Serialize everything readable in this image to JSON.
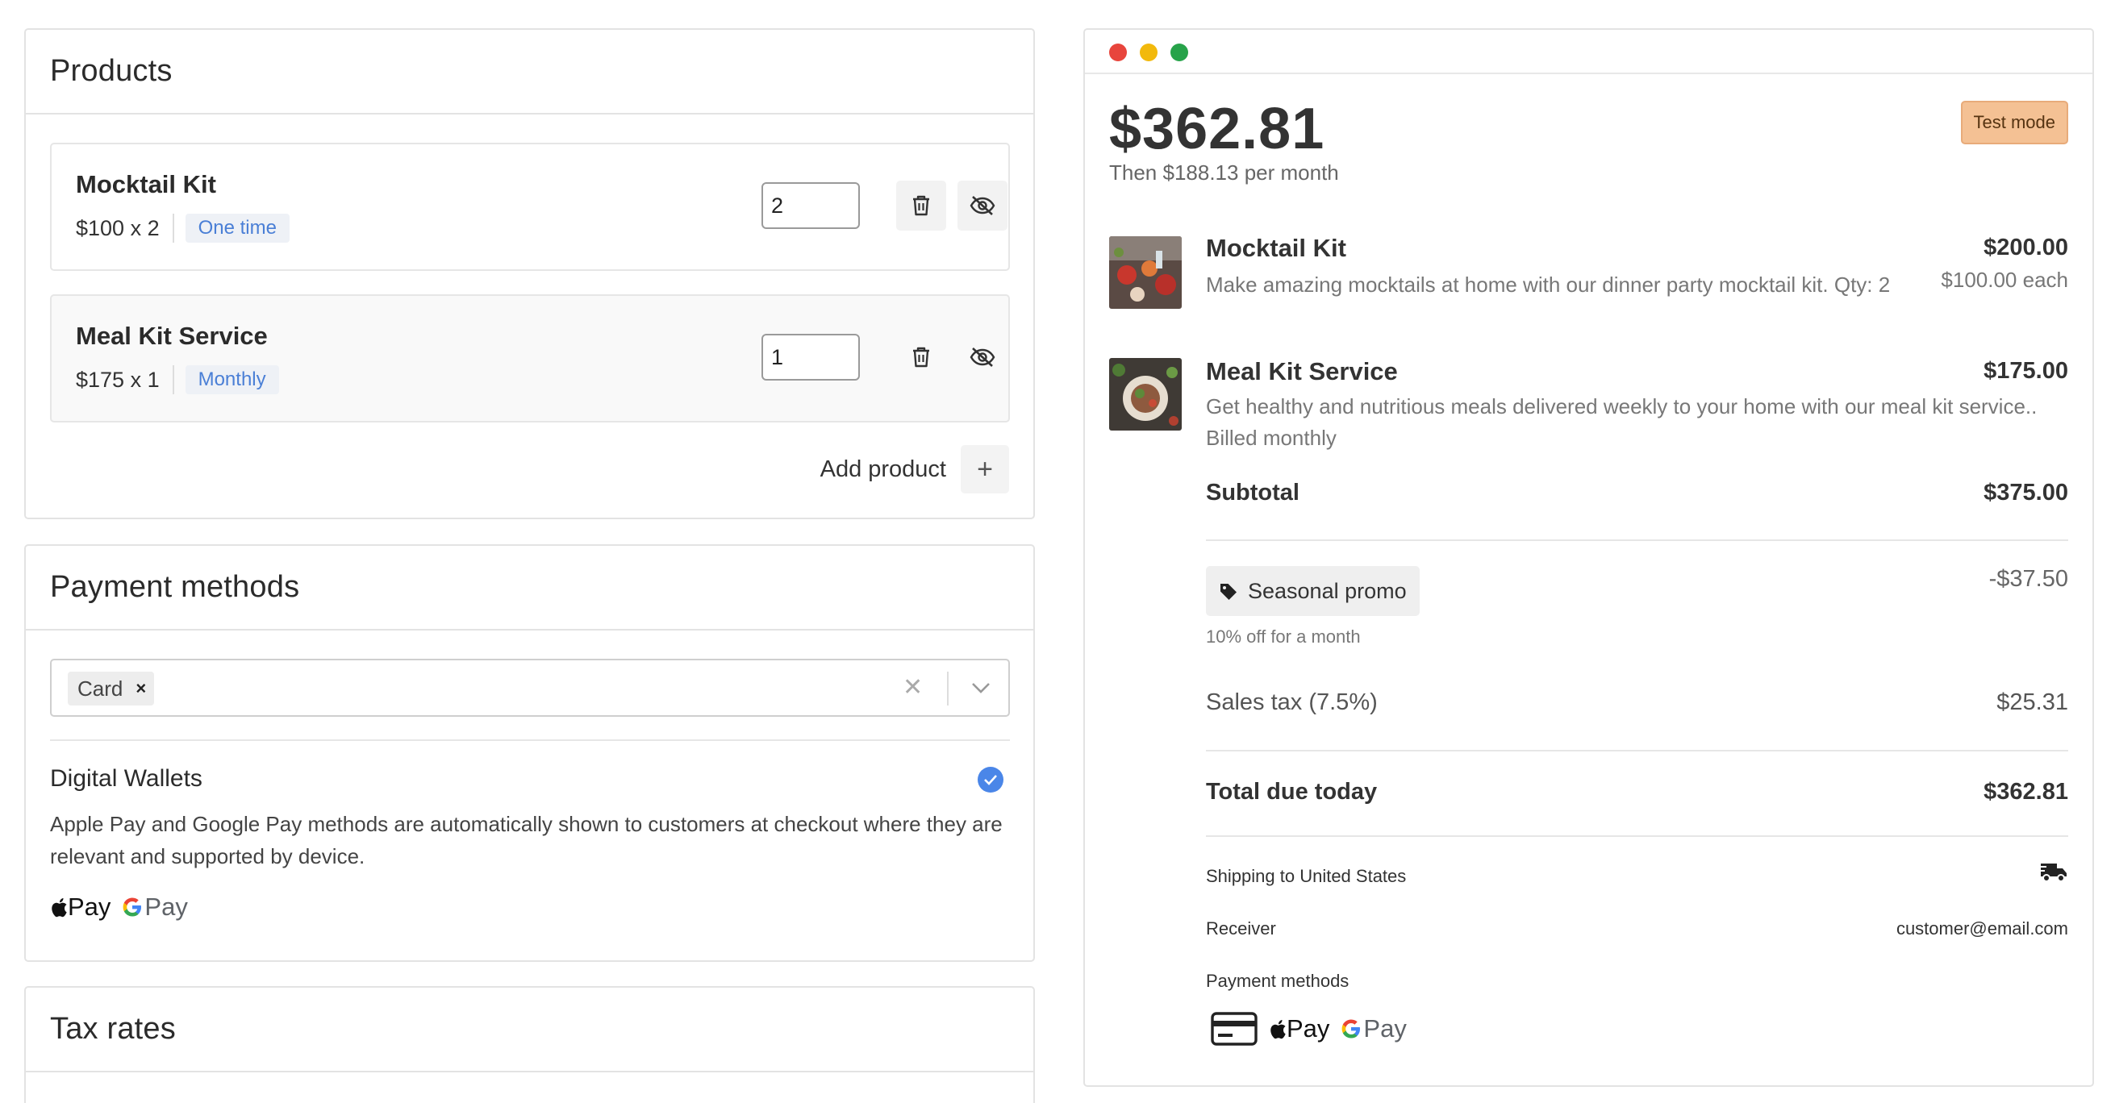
{
  "products_card": {
    "title": "Products",
    "items": [
      {
        "name": "Mocktail Kit",
        "price_line": "$100 x 2",
        "badge": "One time",
        "quantity": "2"
      },
      {
        "name": "Meal Kit Service",
        "price_line": "$175 x 1",
        "badge": "Monthly",
        "quantity": "1"
      }
    ],
    "add_label": "Add product",
    "add_icon": "+"
  },
  "payment_card": {
    "title": "Payment methods",
    "selected": [
      "Card"
    ],
    "chip_remove": "×",
    "clear_icon": "✕",
    "digital_wallets_title": "Digital Wallets",
    "digital_wallets_desc": "Apple Pay and Google Pay methods are automatically shown to customers at checkout where they are relevant and supported by device.",
    "apple_pay": "Pay",
    "google_pay": "Pay"
  },
  "tax_card": {
    "title": "Tax rates"
  },
  "preview": {
    "test_mode": "Test mode",
    "total_amount": "$362.81",
    "then_text": "Then $188.13 per month",
    "line_items": [
      {
        "name": "Mocktail Kit",
        "description": "Make amazing mocktails at home with our dinner party mocktail kit. Qty: 2",
        "price": "$200.00",
        "each": "$100.00 each"
      },
      {
        "name": "Meal Kit Service",
        "description": "Get healthy and nutritious meals delivered weekly to your home with our meal kit service.. Billed monthly",
        "price": "$175.00"
      }
    ],
    "subtotal_label": "Subtotal",
    "subtotal_value": "$375.00",
    "promo_name": "Seasonal promo",
    "promo_desc": "10% off for a month",
    "promo_value": "-$37.50",
    "tax_label": "Sales tax (7.5%)",
    "tax_value": "$25.31",
    "total_label": "Total due today",
    "total_value": "$362.81",
    "shipping_label": "Shipping to United States",
    "receiver_label": "Receiver",
    "receiver_value": "customer@email.com",
    "payment_methods_label": "Payment methods",
    "apple_pay": "Pay",
    "google_pay": "Pay"
  },
  "colors": {
    "badge_blue": "#4a7fd6",
    "check_blue": "#4a86e8",
    "test_mode_bg": "#f4c194",
    "dot_red": "#e8453c",
    "dot_yellow": "#f2b90c",
    "dot_green": "#27a34a"
  }
}
